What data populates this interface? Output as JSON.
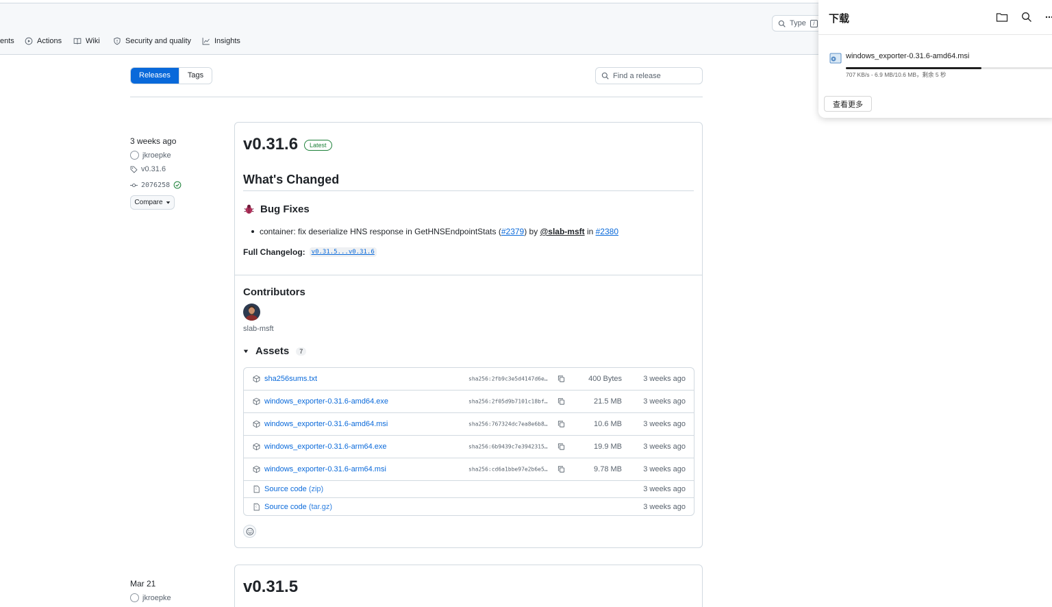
{
  "nav": {
    "items": [
      {
        "label": "ents"
      },
      {
        "label": "Actions"
      },
      {
        "label": "Wiki"
      },
      {
        "label": "Security and quality"
      },
      {
        "label": "Insights"
      }
    ],
    "search_label": "Type",
    "search_kbd": "/"
  },
  "releases_header": {
    "tab_releases": "Releases",
    "tab_tags": "Tags",
    "find_placeholder": "Find a release"
  },
  "release": {
    "date": "3 weeks ago",
    "author": "jkroepke",
    "tag": "v0.31.6",
    "commit": "2076258",
    "compare_label": "Compare",
    "version": "v0.31.6",
    "badge": "Latest",
    "heading": "What's Changed",
    "section": "Bug Fixes",
    "change": {
      "text_before": "container: fix deserialize HNS response in GetHNSEndpointStats (",
      "pr_link": "#2379",
      "text_by": ") by ",
      "user": "@slab-msft",
      "text_in": " in ",
      "pr2_link": "#2380"
    },
    "changelog_label": "Full Changelog:",
    "changelog_link": "v0.31.5...v0.31.6",
    "contributors_title": "Contributors",
    "contributor_name": "slab-msft",
    "assets_title": "Assets",
    "assets_count": "7",
    "assets": [
      {
        "name": "sha256sums.txt",
        "sha": "sha256:2fb9c3e5d4147d6e…",
        "size": "400 Bytes",
        "time": "3 weeks ago"
      },
      {
        "name": "windows_exporter-0.31.6-amd64.exe",
        "sha": "sha256:2f05d9b7101c18bf…",
        "size": "21.5 MB",
        "time": "3 weeks ago"
      },
      {
        "name": "windows_exporter-0.31.6-amd64.msi",
        "sha": "sha256:767324dc7ea8e6b8…",
        "size": "10.6 MB",
        "time": "3 weeks ago"
      },
      {
        "name": "windows_exporter-0.31.6-arm64.exe",
        "sha": "sha256:6b9439c7e3942315…",
        "size": "19.9 MB",
        "time": "3 weeks ago"
      },
      {
        "name": "windows_exporter-0.31.6-arm64.msi",
        "sha": "sha256:cd6a1bbe97e2b6e5…",
        "size": "9.78 MB",
        "time": "3 weeks ago"
      }
    ],
    "source": [
      {
        "name": "Source code",
        "fmt": "(zip)",
        "time": "3 weeks ago"
      },
      {
        "name": "Source code",
        "fmt": "(tar.gz)",
        "time": "3 weeks ago"
      }
    ]
  },
  "release2": {
    "date": "Mar 21",
    "author": "jkroepke",
    "version": "v0.31.5"
  },
  "downloads": {
    "title": "下载",
    "filename": "windows_exporter-0.31.6-amd64.msi",
    "progress": 0.65,
    "status": "707 KB/s - 6.9 MB/10.6 MB，剩余 5 秒",
    "more_label": "查看更多"
  }
}
